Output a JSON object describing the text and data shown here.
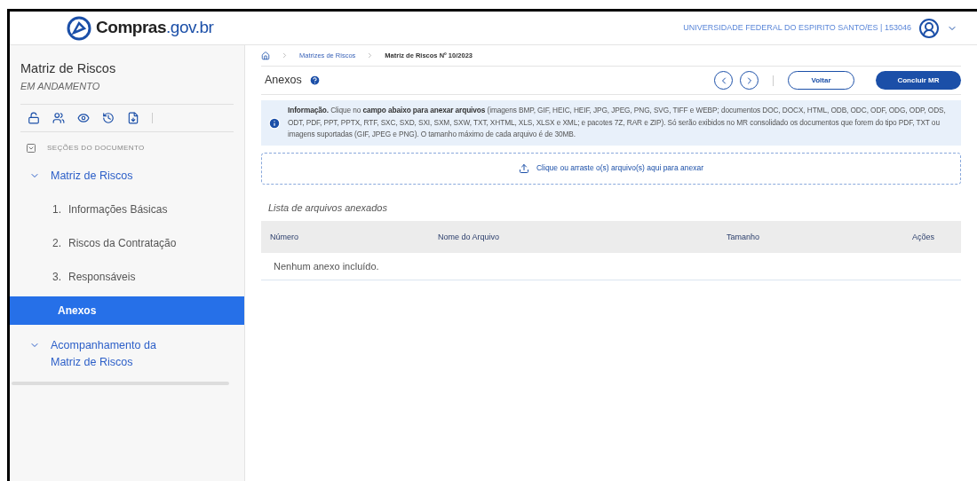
{
  "header": {
    "logo": "Compras",
    "logo_suffix": ".gov.br",
    "organization": "UNIVERSIDADE FEDERAL DO ESPIRITO SANTO/ES | 153046"
  },
  "sidebar": {
    "title": "Matriz de Riscos",
    "status": "EM ANDAMENTO",
    "section_label": "SEÇÕES DO DOCUMENTO",
    "items": [
      {
        "label": "Matriz de Riscos",
        "expanded": true,
        "selected": false,
        "children": [
          {
            "number": "1.",
            "label": "Informações Básicas",
            "selected": false
          },
          {
            "number": "2.",
            "label": "Riscos da Contratação",
            "selected": false
          },
          {
            "number": "3.",
            "label": "Responsáveis",
            "selected": false
          },
          {
            "label": "Anexos",
            "selected": true
          }
        ]
      },
      {
        "label": "Acompanhamento da Matriz de Riscos",
        "expanded": true,
        "selected": false
      }
    ]
  },
  "breadcrumb": [
    "Matrizes de Riscos",
    "Matriz de Riscos Nº 10/2023"
  ],
  "page_title": "Anexos",
  "buttons": {
    "back": "Voltar",
    "primary": "Concluir MR"
  },
  "info": "**Informação.** Clique no **campo abaixo para anexar arquivos** (imagens BMP, GIF, HEIC, HEIF, JPG, JPEG, PNG, SVG, TIFF e WEBP; documentos DOC, DOCX, HTML, ODB, ODC, ODF, ODG, ODP, ODS, ODT, PDF, PPT, PPTX, RTF, SXC, SXD, SXI, SXM, SXW, TXT, XHTML, XLS, XLSX e XML; e pacotes 7Z, RAR e ZIP). Só serão exibidos no MR consolidado os documentos que forem do tipo PDF, TXT ou imagens suportadas (GIF, JPEG e PNG). O tamanho máximo de cada arquivo é de 30MB.",
  "upload": "Clique ou arraste o(s) arquivo(s) aqui para anexar",
  "list_title": "Lista de arquivos anexados",
  "table": {
    "columns": [
      "Número",
      "Nome do Arquivo",
      "Tamanho",
      "Ações"
    ],
    "empty": "Nenhum anexo incluído."
  }
}
